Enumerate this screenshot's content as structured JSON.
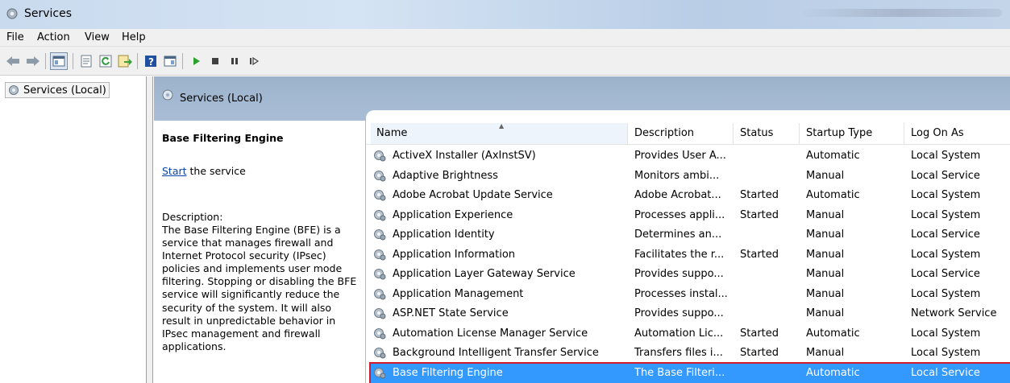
{
  "window": {
    "title": "Services"
  },
  "menu": [
    "File",
    "Action",
    "View",
    "Help"
  ],
  "toolbar": {
    "icons": [
      "back-arrow-icon",
      "forward-arrow-icon",
      "show-hide-tree-icon",
      "properties-icon",
      "refresh-icon",
      "export-list-icon",
      "help-icon",
      "show-action-pane-icon",
      "start-service-icon",
      "stop-service-icon",
      "pause-service-icon",
      "resume-service-icon"
    ]
  },
  "tree": {
    "root": "Services (Local)"
  },
  "header": {
    "title": "Services (Local)"
  },
  "detail": {
    "service_name": "Base Filtering Engine",
    "start_link": "Start",
    "start_suffix": " the service",
    "description_label": "Description:",
    "description": "The Base Filtering Engine (BFE) is a service that manages firewall and Internet Protocol security (IPsec) policies and implements user mode filtering. Stopping or disabling the BFE service will significantly reduce the security of the system. It will also result in unpredictable behavior in IPsec management and firewall applications."
  },
  "columns": [
    "Name",
    "Description",
    "Status",
    "Startup Type",
    "Log On As"
  ],
  "rows": [
    {
      "name": "ActiveX Installer (AxInstSV)",
      "description": "Provides User A...",
      "status": "",
      "startup": "Automatic",
      "logon": "Local System"
    },
    {
      "name": "Adaptive Brightness",
      "description": "Monitors ambi...",
      "status": "",
      "startup": "Manual",
      "logon": "Local Service"
    },
    {
      "name": "Adobe Acrobat Update Service",
      "description": "Adobe Acrobat...",
      "status": "Started",
      "startup": "Automatic",
      "logon": "Local System"
    },
    {
      "name": "Application Experience",
      "description": "Processes appli...",
      "status": "Started",
      "startup": "Manual",
      "logon": "Local System"
    },
    {
      "name": "Application Identity",
      "description": "Determines an...",
      "status": "",
      "startup": "Manual",
      "logon": "Local Service"
    },
    {
      "name": "Application Information",
      "description": "Facilitates the r...",
      "status": "Started",
      "startup": "Manual",
      "logon": "Local System"
    },
    {
      "name": "Application Layer Gateway Service",
      "description": "Provides suppo...",
      "status": "",
      "startup": "Manual",
      "logon": "Local Service"
    },
    {
      "name": "Application Management",
      "description": "Processes instal...",
      "status": "",
      "startup": "Manual",
      "logon": "Local System"
    },
    {
      "name": "ASP.NET State Service",
      "description": "Provides suppo...",
      "status": "",
      "startup": "Manual",
      "logon": "Network Service"
    },
    {
      "name": "Automation License Manager Service",
      "description": "Automation Lic...",
      "status": "Started",
      "startup": "Automatic",
      "logon": "Local System"
    },
    {
      "name": "Background Intelligent Transfer Service",
      "description": "Transfers files i...",
      "status": "Started",
      "startup": "Manual",
      "logon": "Local System"
    },
    {
      "name": "Base Filtering Engine",
      "description": "The Base Filteri...",
      "status": "",
      "startup": "Automatic",
      "logon": "Local Service",
      "selected": true
    }
  ],
  "colors": {
    "selection": "#3399ff",
    "highlight_border": "#d11a2a",
    "header_band": "#a8bdd5"
  }
}
